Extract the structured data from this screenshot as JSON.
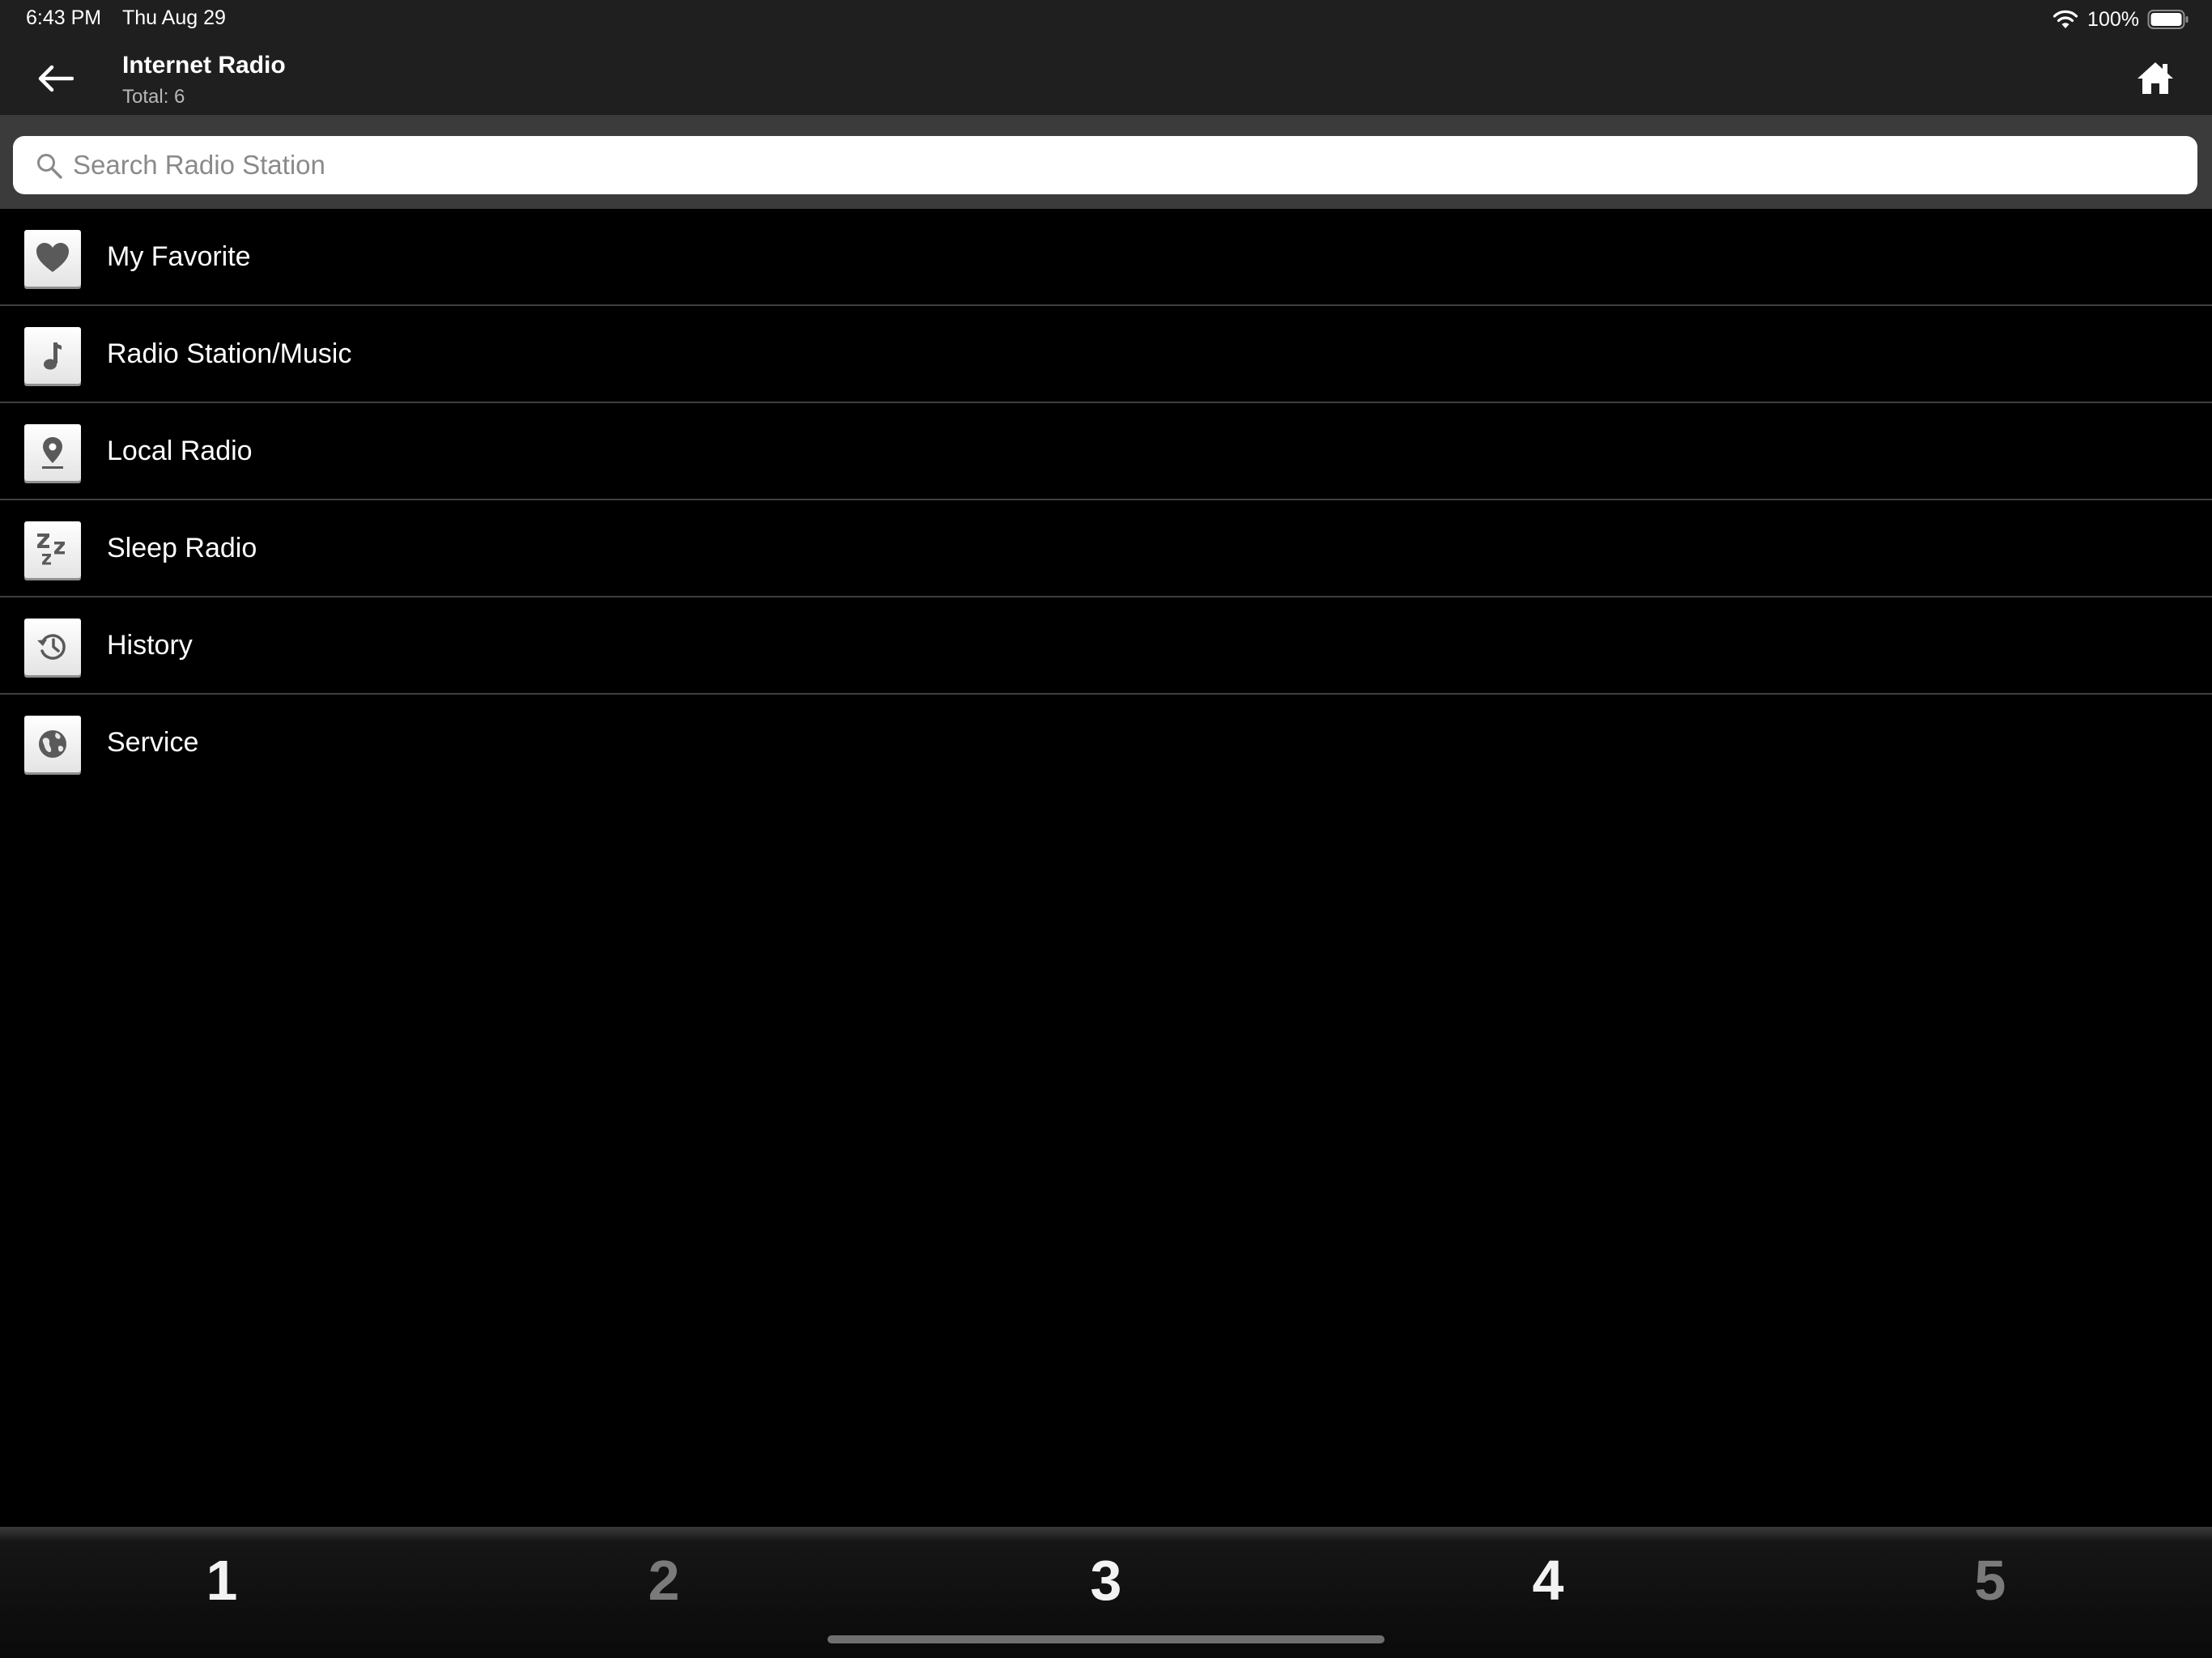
{
  "status_bar": {
    "time": "6:43 PM",
    "date": "Thu Aug 29",
    "battery": "100%"
  },
  "header": {
    "title": "Internet Radio",
    "subtitle": "Total: 6"
  },
  "search": {
    "placeholder": "Search Radio Station",
    "value": ""
  },
  "menu": {
    "items": [
      {
        "label": "My Favorite",
        "icon": "heart-icon"
      },
      {
        "label": "Radio Station/Music",
        "icon": "music-note-icon"
      },
      {
        "label": "Local Radio",
        "icon": "location-pin-icon"
      },
      {
        "label": "Sleep Radio",
        "icon": "sleep-zzz-icon"
      },
      {
        "label": "History",
        "icon": "history-icon"
      },
      {
        "label": "Service",
        "icon": "globe-icon"
      }
    ]
  },
  "tabs": [
    {
      "label": "1",
      "active": true
    },
    {
      "label": "2",
      "active": false
    },
    {
      "label": "3",
      "active": true
    },
    {
      "label": "4",
      "active": true
    },
    {
      "label": "5",
      "active": false
    }
  ],
  "colors": {
    "background": "#000000",
    "header_bg": "#1f1f1f",
    "search_area_bg": "#3b3b3b",
    "divider": "#3e3e3e",
    "tab_active": "#f2f2f2",
    "tab_inactive": "#7a7a7a",
    "icon_glyph": "#5a5a5a"
  }
}
